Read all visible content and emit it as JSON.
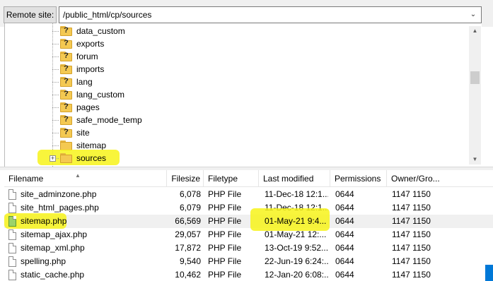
{
  "site_bar": {
    "label": "Remote site:",
    "path": "/public_html/cp/sources",
    "dropdown_icon": "chevron-down-icon"
  },
  "tree": {
    "folders": [
      {
        "name": "data_custom",
        "unknown": true
      },
      {
        "name": "exports",
        "unknown": true
      },
      {
        "name": "forum",
        "unknown": true
      },
      {
        "name": "imports",
        "unknown": true
      },
      {
        "name": "lang",
        "unknown": true
      },
      {
        "name": "lang_custom",
        "unknown": true
      },
      {
        "name": "pages",
        "unknown": true
      },
      {
        "name": "safe_mode_temp",
        "unknown": true
      },
      {
        "name": "site",
        "unknown": true
      },
      {
        "name": "sitemap",
        "unknown": false
      },
      {
        "name": "sources",
        "unknown": false,
        "expandable": true,
        "highlighted": true
      }
    ]
  },
  "filelist": {
    "headers": {
      "filename": "Filename",
      "filesize": "Filesize",
      "filetype": "Filetype",
      "modified": "Last modified",
      "permissions": "Permissions",
      "owner": "Owner/Gro..."
    },
    "rows": [
      {
        "name": "site_adminzone.php",
        "size": "6,078",
        "type": "PHP File",
        "modified": "11-Dec-18 12:1...",
        "perm": "0644",
        "owner": "1147 1150"
      },
      {
        "name": "site_html_pages.php",
        "size": "6,079",
        "type": "PHP File",
        "modified": "11-Dec-18 12:1...",
        "perm": "0644",
        "owner": "1147 1150"
      },
      {
        "name": "sitemap.php",
        "size": "66,569",
        "type": "PHP File",
        "modified": "01-May-21 9:4...",
        "perm": "0644",
        "owner": "1147 1150",
        "highlighted": true
      },
      {
        "name": "sitemap_ajax.php",
        "size": "29,057",
        "type": "PHP File",
        "modified": "01-May-21 12:...",
        "perm": "0644",
        "owner": "1147 1150"
      },
      {
        "name": "sitemap_xml.php",
        "size": "17,872",
        "type": "PHP File",
        "modified": "13-Oct-19 9:52...",
        "perm": "0644",
        "owner": "1147 1150"
      },
      {
        "name": "spelling.php",
        "size": "9,540",
        "type": "PHP File",
        "modified": "22-Jun-19 6:24:...",
        "perm": "0644",
        "owner": "1147 1150"
      },
      {
        "name": "static_cache.php",
        "size": "10,462",
        "type": "PHP File",
        "modified": "12-Jan-20 6:08:...",
        "perm": "0644",
        "owner": "1147 1150"
      }
    ]
  },
  "colors": {
    "highlight": "#f7f31a",
    "folder": "#f4c952",
    "selected_row": "#f0f0f0"
  }
}
